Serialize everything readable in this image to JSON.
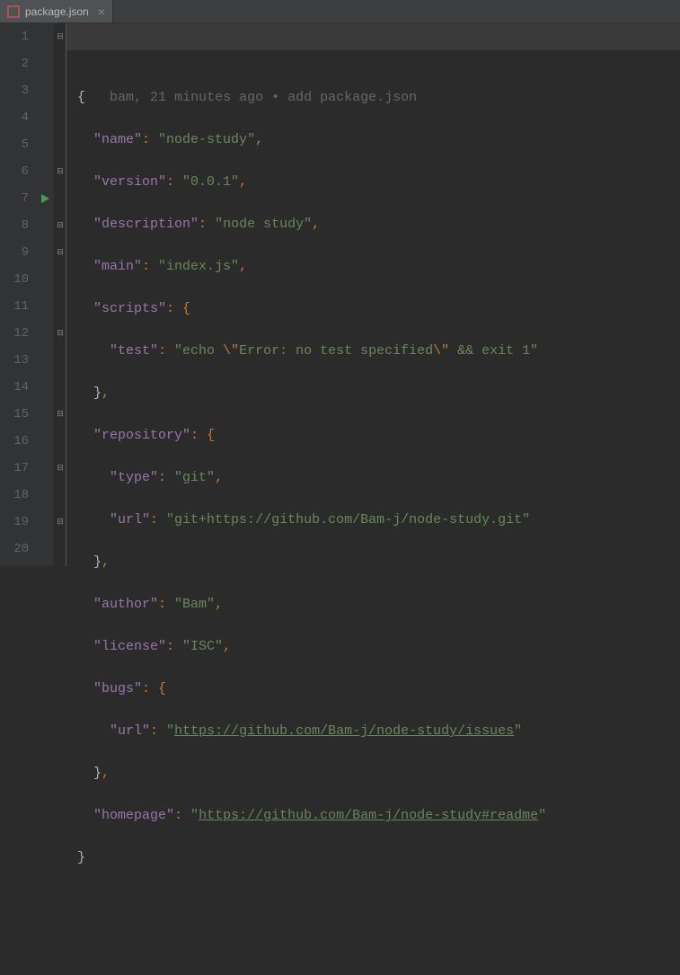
{
  "tab": {
    "filename": "package.json",
    "close": "×"
  },
  "blame": {
    "author": "bam",
    "time": "21 minutes ago",
    "sep": "•",
    "message": "add package.json"
  },
  "lineNumbers": [
    "1",
    "2",
    "3",
    "4",
    "5",
    "6",
    "7",
    "8",
    "9",
    "10",
    "11",
    "12",
    "13",
    "14",
    "15",
    "16",
    "17",
    "18",
    "19",
    "20"
  ],
  "json": {
    "name_key": "\"name\"",
    "name_val": "\"node-study\"",
    "version_key": "\"version\"",
    "version_val": "\"0.0.1\"",
    "description_key": "\"description\"",
    "description_val": "\"node study\"",
    "main_key": "\"main\"",
    "main_val": "\"index.js\"",
    "scripts_key": "\"scripts\"",
    "test_key": "\"test\"",
    "test_val_prefix": "\"echo ",
    "test_esc1": "\\\"",
    "test_val_mid": "Error: no test specified",
    "test_esc2": "\\\"",
    "test_val_suffix": " && exit 1\"",
    "repository_key": "\"repository\"",
    "type_key": "\"type\"",
    "type_val": "\"git\"",
    "url_key": "\"url\"",
    "repo_url_val": "\"git+https://github.com/Bam-j/node-study.git\"",
    "author_key": "\"author\"",
    "author_val": "\"Bam\"",
    "license_key": "\"license\"",
    "license_val": "\"ISC\"",
    "bugs_key": "\"bugs\"",
    "bugs_url_q1": "\"",
    "bugs_url_val": "https://github.com/Bam-j/node-study/issues",
    "bugs_url_q2": "\"",
    "homepage_key": "\"homepage\"",
    "homepage_q1": "\"",
    "homepage_val": "https://github.com/Bam-j/node-study#readme",
    "homepage_q2": "\""
  },
  "punct": {
    "colon": ": ",
    "comma": ",",
    "obrace": "{",
    "cbrace": "}",
    "obrace_after": ": {"
  }
}
